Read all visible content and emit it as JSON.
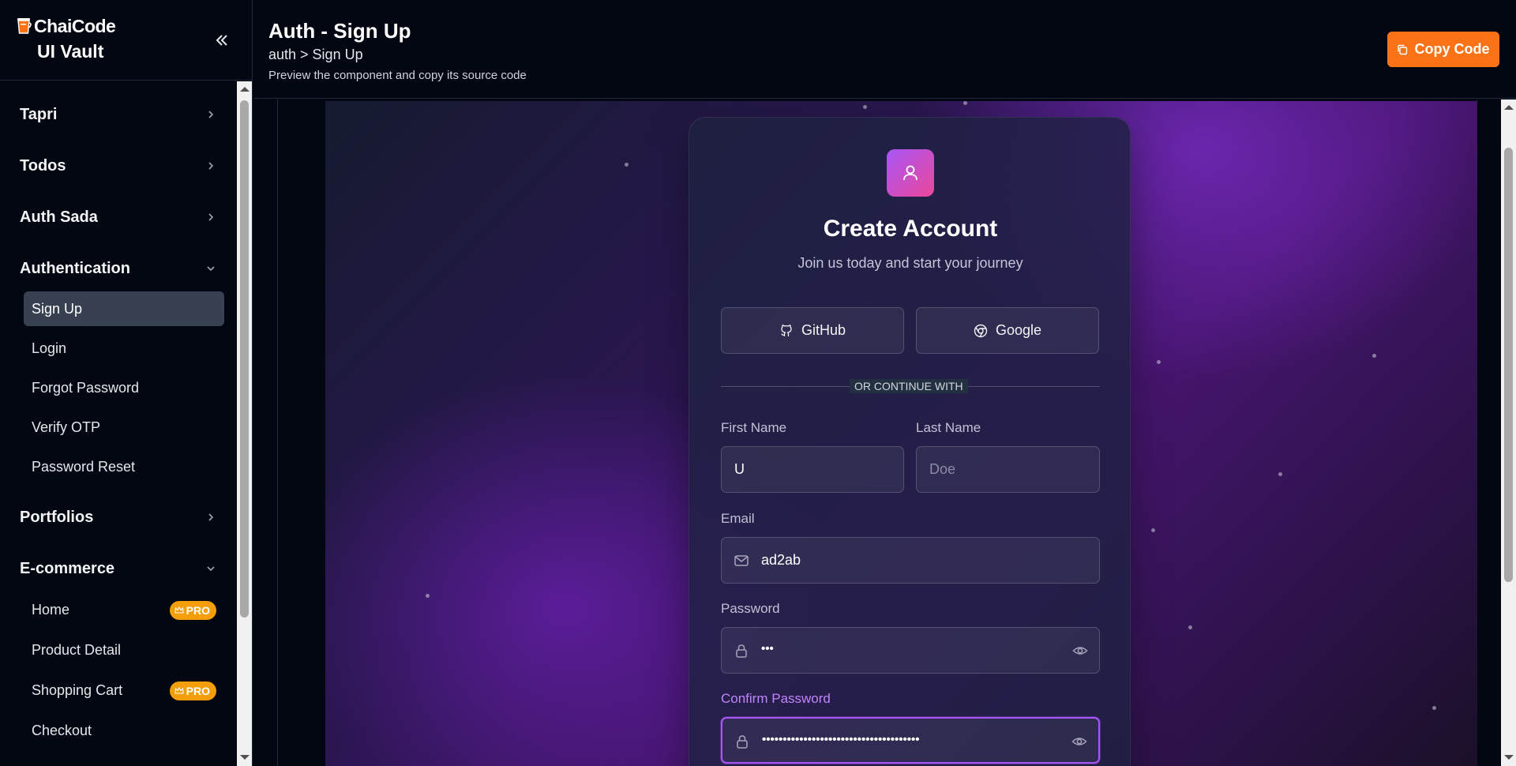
{
  "brand": {
    "name": "ChaiCode",
    "subtitle": "UI Vault"
  },
  "header": {
    "title": "Auth - Sign Up",
    "breadcrumb": "auth > Sign Up",
    "description": "Preview the component and copy its source code",
    "copy_label": "Copy Code"
  },
  "sidebar": {
    "groups": [
      {
        "label": "Tapri",
        "expanded": false
      },
      {
        "label": "Todos",
        "expanded": false
      },
      {
        "label": "Auth Sada",
        "expanded": false
      },
      {
        "label": "Authentication",
        "expanded": true
      },
      {
        "label": "Portfolios",
        "expanded": false
      },
      {
        "label": "E-commerce",
        "expanded": true
      }
    ],
    "auth_items": [
      {
        "label": "Sign Up",
        "active": true
      },
      {
        "label": "Login"
      },
      {
        "label": "Forgot Password"
      },
      {
        "label": "Verify OTP"
      },
      {
        "label": "Password Reset"
      }
    ],
    "ecommerce_items": [
      {
        "label": "Home",
        "badge": "PRO"
      },
      {
        "label": "Product Detail"
      },
      {
        "label": "Shopping Cart",
        "badge": "PRO"
      },
      {
        "label": "Checkout"
      }
    ]
  },
  "signup": {
    "title": "Create Account",
    "subtitle": "Join us today and start your journey",
    "github_label": "GitHub",
    "google_label": "Google",
    "divider": "OR CONTINUE WITH",
    "first_name_label": "First Name",
    "first_name_value": "U",
    "last_name_label": "Last Name",
    "last_name_placeholder": "Doe",
    "email_label": "Email",
    "email_value": "ad2ab",
    "password_label": "Password",
    "password_value": "•••",
    "confirm_label": "Confirm Password",
    "confirm_value": "••••••••••••••••••••••••••••••••••••••"
  },
  "colors": {
    "accent": "#f97316",
    "pro_badge": "#f59e0b",
    "focus": "#a855f7",
    "avatar_gradient_start": "#a855f7",
    "avatar_gradient_end": "#ec4899"
  },
  "icons": {
    "collapse": "chevrons-left-icon",
    "copy": "copy-icon",
    "user": "user-icon",
    "github": "github-icon",
    "google": "chrome-icon",
    "mail": "mail-icon",
    "lock": "lock-icon",
    "eye": "eye-icon",
    "crown": "crown-icon"
  }
}
